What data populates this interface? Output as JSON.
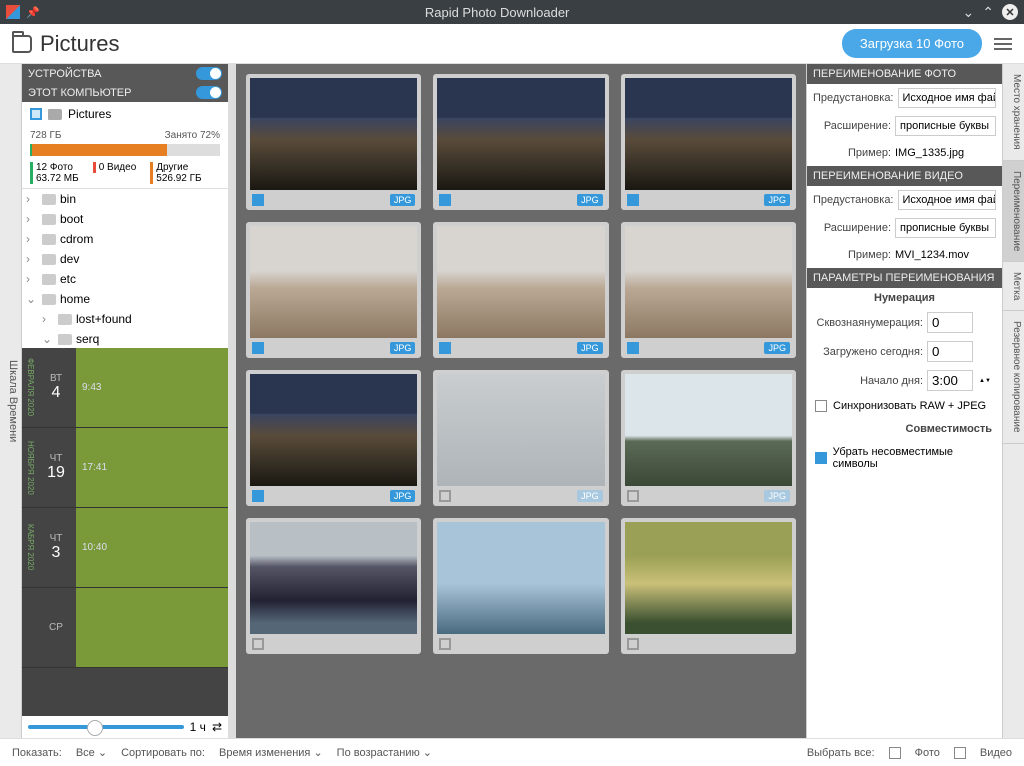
{
  "title": "Rapid Photo Downloader",
  "header": {
    "location": "Pictures",
    "download_btn": "Загрузка 10 Фото"
  },
  "vtab_left": "Шкала Времени",
  "panels": {
    "devices": "УСТРОЙСТВА",
    "this_pc": "ЭТОТ КОМПЬЮТЕР",
    "source": "Pictures"
  },
  "storage": {
    "total": "728 ГБ",
    "used_pct": "Занято 72%",
    "fill_pct": 72,
    "stats": [
      {
        "label": "12 Фото",
        "sub": "63.72 МБ",
        "color": "#27ae60"
      },
      {
        "label": "0 Видео",
        "sub": "",
        "color": "#e74c3c"
      },
      {
        "label": "Другие",
        "sub": "526.92 ГБ",
        "color": "#e67e22"
      }
    ]
  },
  "tree": [
    {
      "name": "bin",
      "depth": 0,
      "exp": false
    },
    {
      "name": "boot",
      "depth": 0,
      "exp": false
    },
    {
      "name": "cdrom",
      "depth": 0,
      "exp": false
    },
    {
      "name": "dev",
      "depth": 0,
      "exp": false
    },
    {
      "name": "etc",
      "depth": 0,
      "exp": false
    },
    {
      "name": "home",
      "depth": 0,
      "exp": true
    },
    {
      "name": "lost+found",
      "depth": 1,
      "exp": false
    },
    {
      "name": "serq",
      "depth": 1,
      "exp": true
    }
  ],
  "timeline": [
    {
      "month": "ФЕВРАЛЯ 2020",
      "dow": "ВТ",
      "day": "4",
      "time": "9:43"
    },
    {
      "month": "НОЯБРЯ 2020",
      "dow": "ЧТ",
      "day": "19",
      "time": "17:41"
    },
    {
      "month": "КАБРЯ 2020",
      "dow": "ЧТ",
      "day": "3",
      "time": "10:40"
    },
    {
      "month": "",
      "dow": "СР",
      "day": "",
      "time": ""
    }
  ],
  "slider_label": "1 ч",
  "thumbs": [
    {
      "sel": true,
      "fmt": "JPG",
      "cls": "p1"
    },
    {
      "sel": true,
      "fmt": "JPG",
      "cls": "p1"
    },
    {
      "sel": true,
      "fmt": "JPG",
      "cls": "p1"
    },
    {
      "sel": true,
      "fmt": "JPG",
      "cls": "p2"
    },
    {
      "sel": true,
      "fmt": "JPG",
      "cls": "p2"
    },
    {
      "sel": true,
      "fmt": "JPG",
      "cls": "p2"
    },
    {
      "sel": true,
      "fmt": "JPG",
      "cls": "p1"
    },
    {
      "sel": false,
      "fmt": "JPG",
      "cls": "p3"
    },
    {
      "sel": false,
      "fmt": "JPG",
      "cls": "p4"
    },
    {
      "sel": false,
      "fmt": "",
      "cls": "p5"
    },
    {
      "sel": false,
      "fmt": "",
      "cls": "p6"
    },
    {
      "sel": false,
      "fmt": "",
      "cls": "p7"
    }
  ],
  "right": {
    "photo_head": "ПЕРЕИМЕНОВАНИЕ ФОТО",
    "video_head": "ПЕРЕИМЕНОВАНИЕ ВИДЕО",
    "param_head": "ПАРАМЕТРЫ ПЕРЕИМЕНОВАНИЯ",
    "preset_lbl": "Предустановка:",
    "ext_lbl": "Расширение:",
    "example_lbl": "Пример:",
    "preset_val": "Исходное имя файла",
    "ext_val": "прописные буквы",
    "photo_ex": "IMG_1335.jpg",
    "video_ex": "MVI_1234.mov",
    "numbering": "Нумерация",
    "seq_lbl": "Сквознаянумерация:",
    "seq_val": "0",
    "today_lbl": "Загружено сегодня:",
    "today_val": "0",
    "daystart_lbl": "Начало дня:",
    "daystart_val": "3:00",
    "sync_lbl": "Синхронизовать RAW + JPEG",
    "compat": "Совместимость",
    "strip_lbl": "Убрать несовместимые символы"
  },
  "vtabs_right": [
    "Место хранения",
    "Переименование",
    "Метка",
    "Резервное копирование"
  ],
  "bottom": {
    "show": "Показать:",
    "show_val": "Все",
    "sort": "Сортировать по:",
    "sort_val": "Время изменения",
    "order": "По возрастанию",
    "select_all": "Выбрать все:",
    "photo": "Фото",
    "video": "Видео"
  }
}
